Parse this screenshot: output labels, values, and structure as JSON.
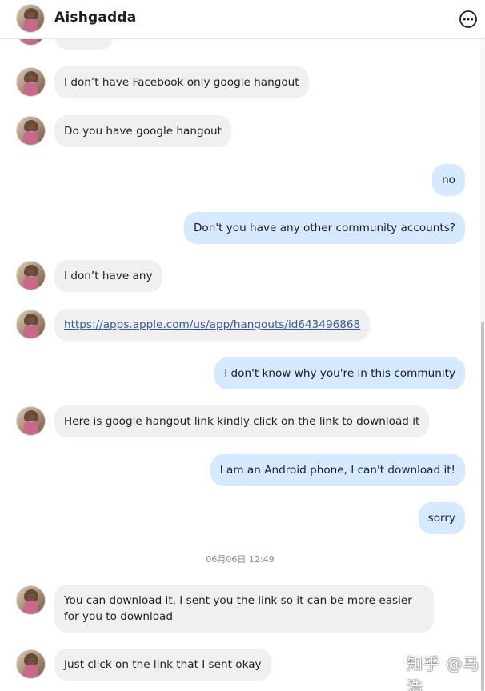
{
  "header": {
    "contact_name": "Aishgadda",
    "more_icon": "ellipsis-circle-icon"
  },
  "messages": [
    {
      "side": "in",
      "text": "I don’t have Facebook only google hangout"
    },
    {
      "side": "in",
      "text": "Do you have google hangout"
    },
    {
      "side": "out",
      "text": "no"
    },
    {
      "side": "out",
      "text": "Don't you have any other community accounts?"
    },
    {
      "side": "in",
      "text": "I don’t have any"
    },
    {
      "side": "in",
      "text": "https://apps.apple.com/us/app/hangouts/id643496868",
      "is_link": true
    },
    {
      "side": "out",
      "text": "I don't know why you're in this community"
    },
    {
      "side": "in",
      "text": "Here is google hangout link kindly click on the link to download it"
    },
    {
      "side": "out",
      "text": "I am an Android phone, I can't download it!"
    },
    {
      "side": "out",
      "text": "sorry"
    },
    {
      "side": "in",
      "text": "You can download it, I sent you the link so it can be more easier for you to download"
    },
    {
      "side": "in",
      "text": "Just click on the link that I sent okay"
    }
  ],
  "timestamp": "06月06日 12:49",
  "watermark": "知乎 @马浩",
  "colors": {
    "incoming_bubble": "#f0f0f0",
    "outgoing_bubble": "#d6eaff",
    "link": "#385898"
  }
}
